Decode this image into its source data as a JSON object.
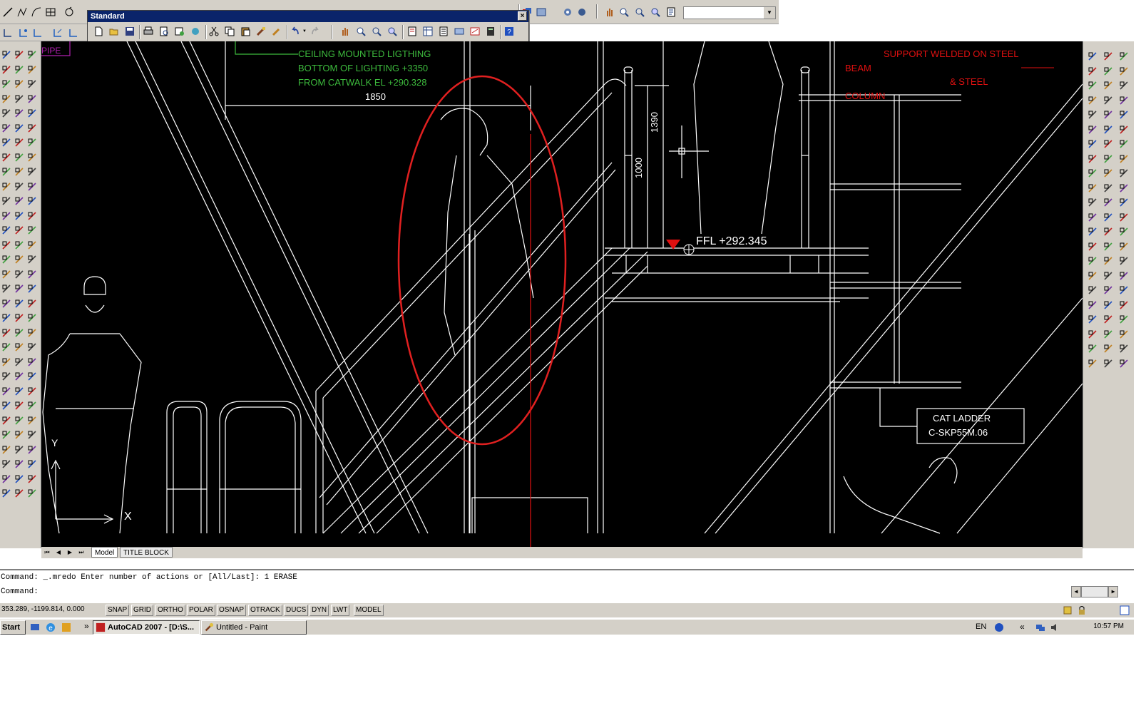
{
  "standard_toolbar": {
    "title": "Standard",
    "close_symbol": "×"
  },
  "drawing": {
    "notes": {
      "pipe": "PIPE",
      "ceiling_line1": "CEILING MOUNTED LIGTHING",
      "ceiling_line2": "BOTTOM OF LIGHTING +3350",
      "ceiling_line3": "FROM CATWALK EL +290.328",
      "support": "SUPPORT WELDED ON STEEL",
      "beam": "BEAM",
      "and_steel": "& STEEL",
      "column": "COLUMN",
      "ffl": "FFL +292.345",
      "cat_ladder_line1": "CAT LADDER",
      "cat_ladder_line2": "C-SKP55M.06",
      "ucs_y": "Y",
      "ucs_x": "X"
    },
    "dimensions": {
      "width": "1850",
      "height_upper": "1390",
      "height_rail": "1000"
    },
    "colors": {
      "background": "#000000",
      "lines": "#ffffff",
      "note_green": "#3dbb3d",
      "note_red": "#e01010",
      "highlight": "#e02020"
    }
  },
  "layout_tabs": {
    "model": "Model",
    "title_block": "TITLE BLOCK"
  },
  "command_line": {
    "history": "Command: _.mredo Enter number of actions or [All/Last]: 1 ERASE",
    "prompt": "Command:"
  },
  "status_bar": {
    "coordinates": "353.289, -1199.814, 0.000",
    "buttons": [
      "SNAP",
      "GRID",
      "ORTHO",
      "POLAR",
      "OSNAP",
      "OTRACK",
      "DUCS",
      "DYN",
      "LWT",
      "MODEL"
    ]
  },
  "taskbar": {
    "start": "Start",
    "quicklaunch_more": "»",
    "tasks": [
      "AutoCAD 2007 - [D:\\S...",
      "Untitled - Paint"
    ],
    "language": "EN",
    "tray_more": "«",
    "clock": "10:57 PM"
  }
}
